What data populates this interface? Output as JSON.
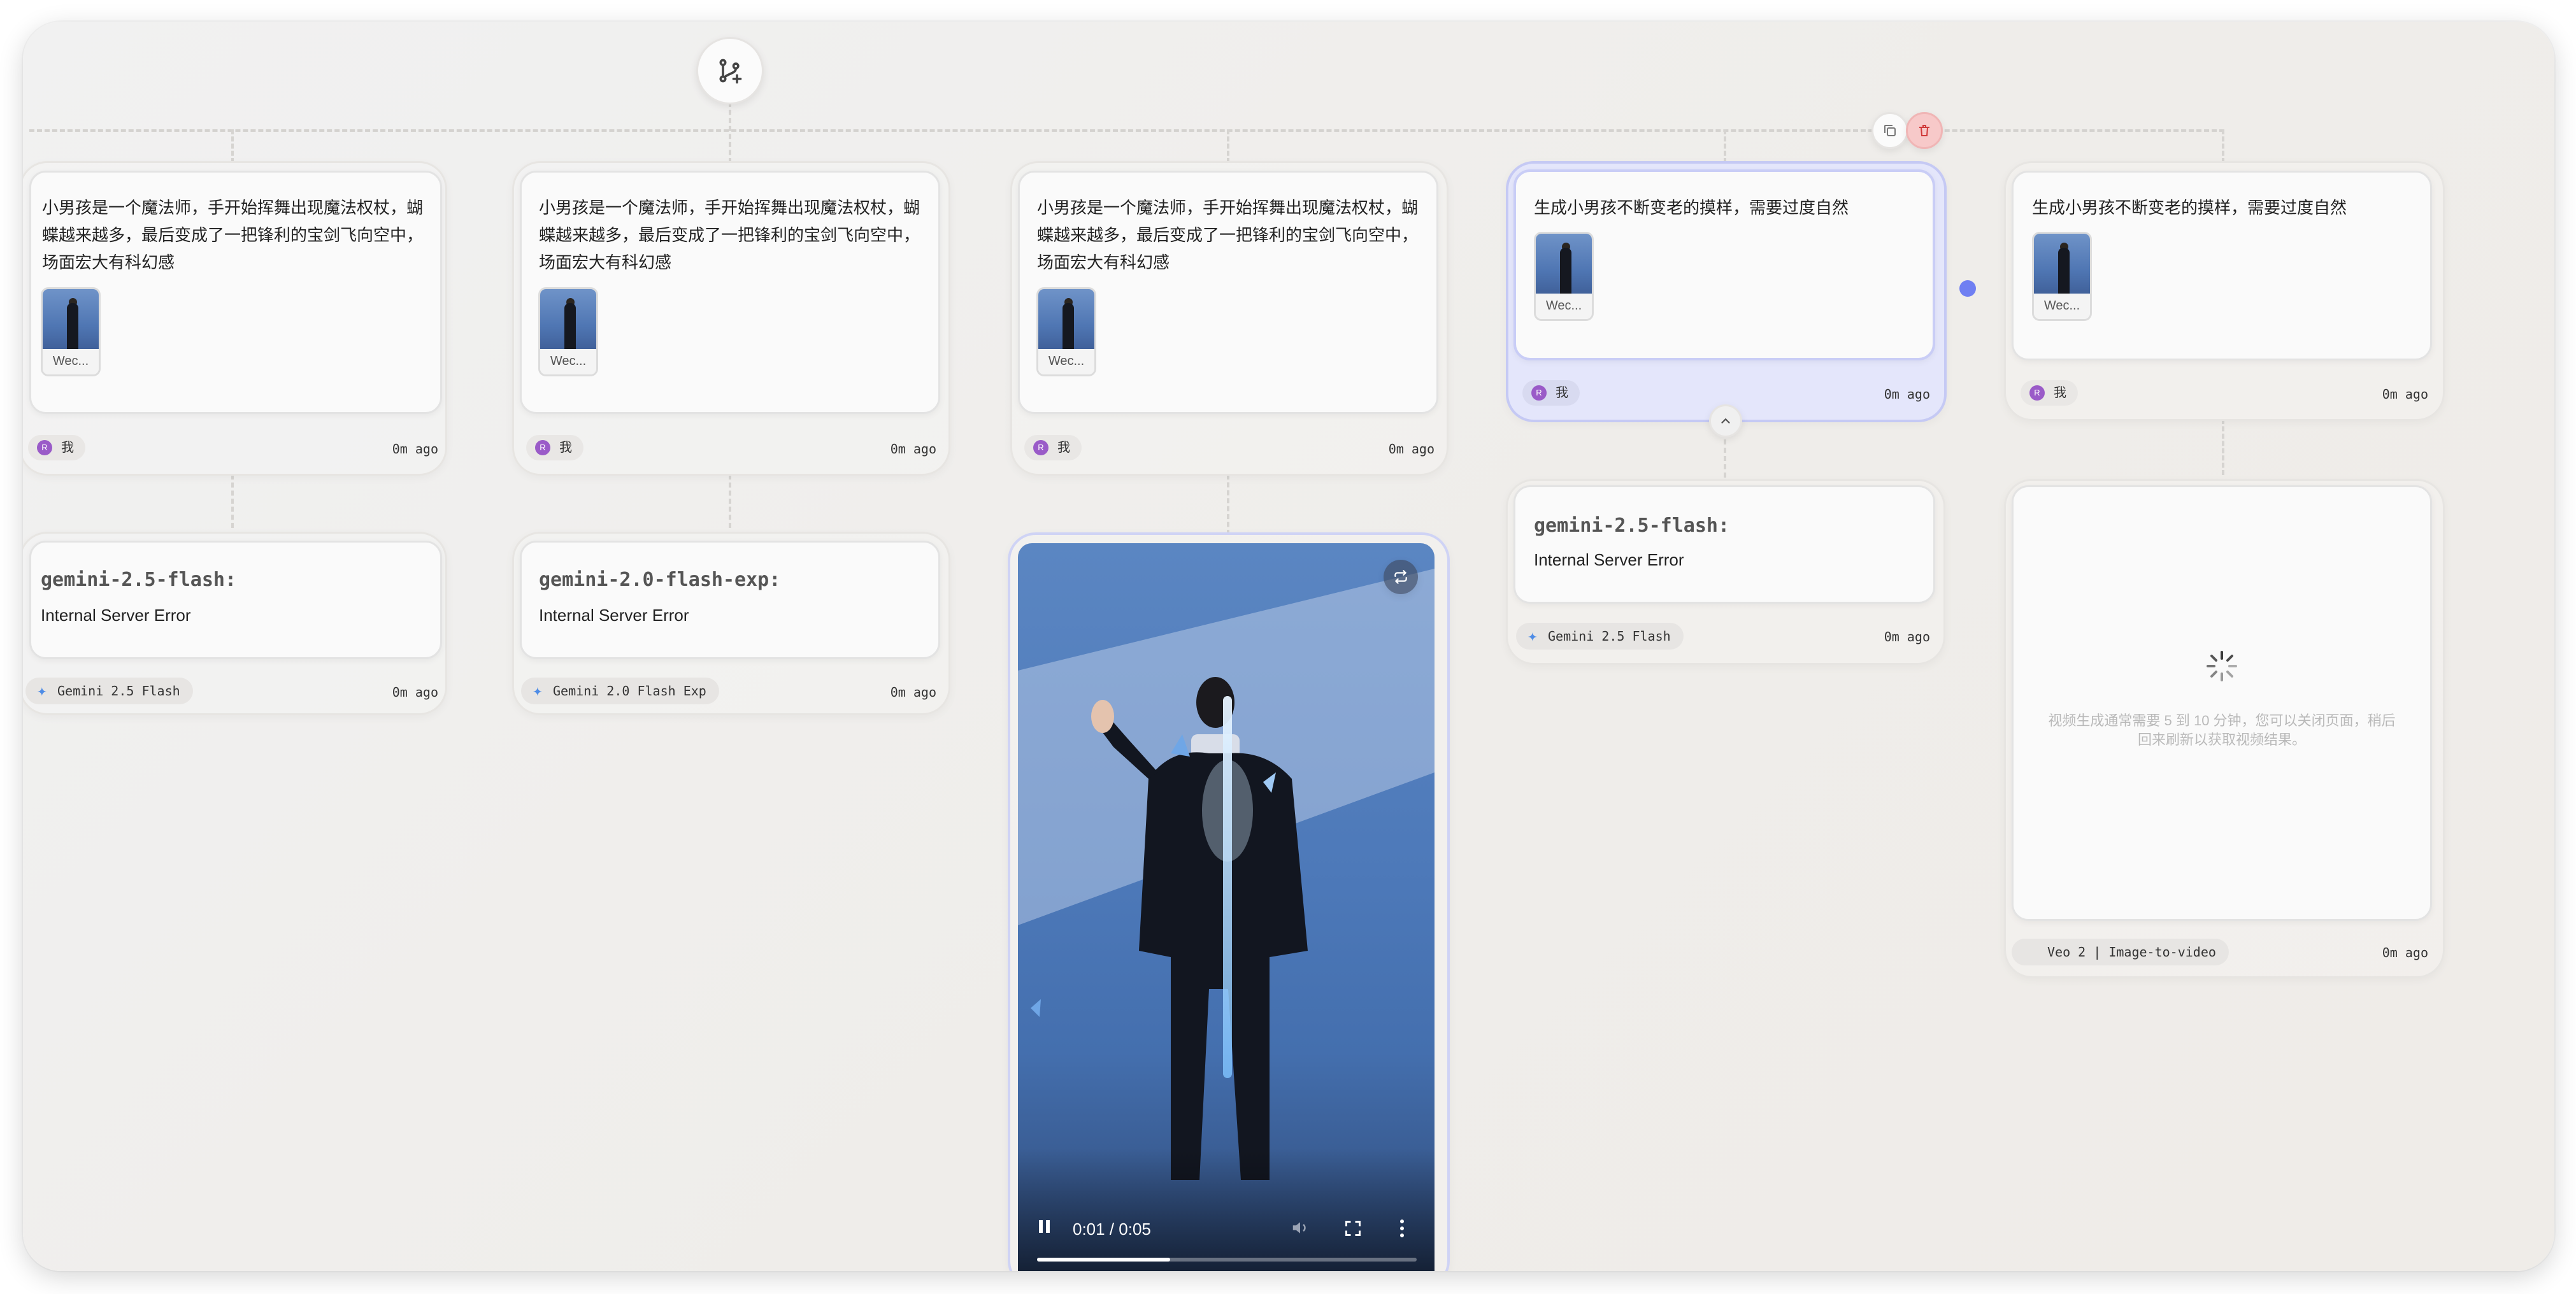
{
  "prompts": {
    "magic": "小男孩是一个魔法师，手开始挥舞出现魔法权杖，蝴蝶越来越多，最后变成了一把锋利的宝剑飞向空中，场面宏大有科幻感",
    "aging": "生成小男孩不断变老的摸样，需要过度自然"
  },
  "attachment_label": "Wec...",
  "user_label": "我",
  "user_avatar_letter": "R",
  "time_label": "0m ago",
  "responses": {
    "r1": {
      "title": "gemini-2.5-flash:",
      "message": "Internal Server Error",
      "model": "Gemini 2.5 Flash"
    },
    "r2": {
      "title": "gemini-2.0-flash-exp:",
      "message": "Internal Server Error",
      "model": "Gemini 2.0 Flash Exp"
    },
    "r4": {
      "title": "gemini-2.5-flash:",
      "message": "Internal Server Error",
      "model": "Gemini 2.5 Flash"
    }
  },
  "video_player": {
    "time": "0:01 / 0:05",
    "progress": 0.35
  },
  "pending": {
    "message": "视频生成通常需要 5 到 10 分钟，您可以关闭页面，稍后回来刷新以获取视频结果。",
    "model": "Veo 2 | Image-to-video"
  },
  "colors": {
    "accent": "#6f7ff2",
    "selected_bg": "#e4e6fb",
    "delete_bg": "#f7c9c9",
    "avatar": "#9a5bc8"
  }
}
